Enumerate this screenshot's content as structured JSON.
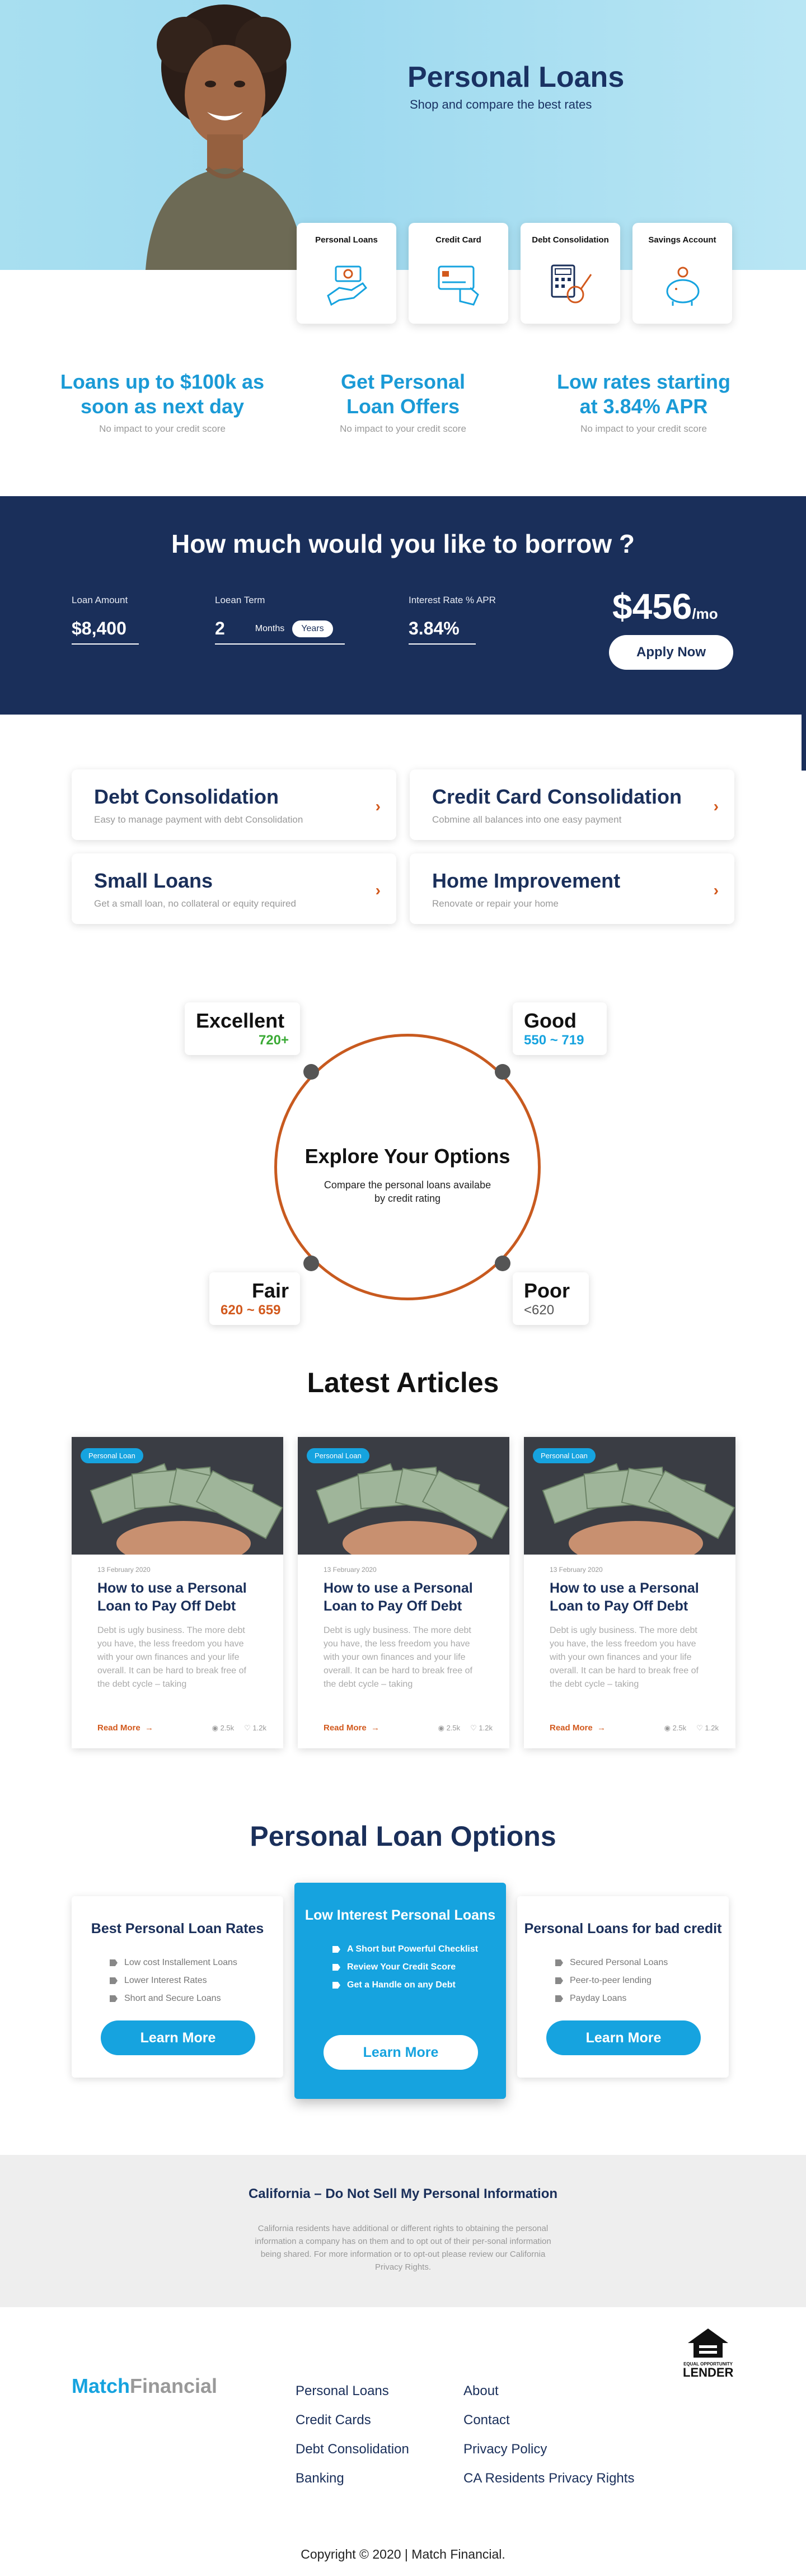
{
  "hero": {
    "title": "Personal Loans",
    "subtitle": "Shop and compare the best rates",
    "categories": [
      {
        "label": "Personal Loans",
        "icon": "hand-money-icon"
      },
      {
        "label": "Credit Card",
        "icon": "credit-card-hand-icon"
      },
      {
        "label": "Debt Consolidation",
        "icon": "calculator-invoice-icon"
      },
      {
        "label": "Savings Account",
        "icon": "piggy-bank-icon"
      }
    ]
  },
  "features": [
    {
      "title": "Loans up to $100k as soon as next day",
      "note": "No impact to your credit score"
    },
    {
      "title": "Get Personal Loan Offers",
      "note": "No impact to your credit score"
    },
    {
      "title": "Low rates starting at 3.84% APR",
      "note": "No impact to your credit score"
    }
  ],
  "borrow": {
    "title": "How much would you like to borrow ?",
    "amount_label": "Loan Amount",
    "amount_value": "$8,400",
    "term_label": "Loean Term",
    "term_value": "2",
    "term_unit_months": "Months",
    "term_unit_years": "Years",
    "rate_label": "Interest Rate % APR",
    "rate_value": "3.84%",
    "monthly_value": "$456",
    "monthly_unit": "/mo",
    "apply_label": "Apply Now"
  },
  "loan_types": [
    {
      "title": "Debt Consolidation",
      "desc": "Easy to manage payment with debt Consolidation"
    },
    {
      "title": "Credit Card Consolidation",
      "desc": "Cobmine all balances into one easy payment"
    },
    {
      "title": "Small Loans",
      "desc": "Get a small loan, no collateral or equity required"
    },
    {
      "title": "Home Improvement",
      "desc": "Renovate or repair your home"
    }
  ],
  "explore": {
    "title": "Explore Your Options",
    "subtitle": "Compare the personal loans availabe by credit rating",
    "ratings": [
      {
        "name": "Excellent",
        "range": "720+",
        "color": "#3aaa35"
      },
      {
        "name": "Good",
        "range": "550 ~ 719",
        "color": "#16a3df"
      },
      {
        "name": "Fair",
        "range": "620 ~ 659",
        "color": "#d2591d"
      },
      {
        "name": "Poor",
        "range": "<620",
        "color": "#555555"
      }
    ]
  },
  "articles": {
    "title": "Latest Articles",
    "items": [
      {
        "tag": "Personal Loan",
        "date": "13 February 2020",
        "title": "How to use a Personal Loan to Pay Off Debt",
        "excerpt": "Debt is ugly business. The more debt you have, the less freedom you have with your own finances and your life overall. It can be hard to break free of the debt cycle – taking",
        "read": "Read More",
        "views": "2.5k",
        "likes": "1.2k"
      },
      {
        "tag": "Personal Loan",
        "date": "13 February 2020",
        "title": "How to use a Personal Loan to Pay Off Debt",
        "excerpt": "Debt is ugly business. The more debt you have, the less freedom you have with your own finances and your life overall. It can be hard to break free of the debt cycle – taking",
        "read": "Read More",
        "views": "2.5k",
        "likes": "1.2k"
      },
      {
        "tag": "Personal Loan",
        "date": "13 February 2020",
        "title": "How to use a Personal Loan to Pay Off Debt",
        "excerpt": "Debt is ugly business. The more debt you have, the less freedom you have with your own finances and your life overall. It can be hard to break free of the debt cycle – taking",
        "read": "Read More",
        "views": "2.5k",
        "likes": "1.2k"
      }
    ]
  },
  "options": {
    "title": "Personal Loan Options",
    "items": [
      {
        "title": "Best Personal Loan Rates",
        "bullets": [
          "Low cost Installement Loans",
          "Lower Interest Rates",
          "Short and Secure Loans"
        ],
        "button": "Learn More"
      },
      {
        "title": "Low Interest Personal Loans",
        "bullets": [
          "A Short but Powerful Checklist",
          "Review Your Credit Score",
          "Get a Handle on any  Debt"
        ],
        "button": "Learn More"
      },
      {
        "title": "Personal Loans for bad credit",
        "bullets": [
          "Secured Personal Loans",
          "Peer-to-peer lending",
          "Payday Loans"
        ],
        "button": "Learn More"
      }
    ]
  },
  "california": {
    "title": "California – Do Not Sell My Personal Information",
    "text": "California residents have additional or different rights to obtaining the personal information a company has on them and to opt out of their per-sonal information being shared. For more information or to opt-out please review our California Privacy Rights."
  },
  "footer": {
    "logo_a": "Match",
    "logo_b": "Financial",
    "col1": [
      "Personal Loans",
      "Credit Cards",
      "Debt Consolidation",
      "Banking"
    ],
    "col2": [
      "About",
      "Contact",
      "Privacy Policy",
      "CA Residents Privacy Rights"
    ],
    "lender_cap": "EQUAL OPPORTUNITY",
    "lender_big": "LENDER",
    "copyright": "Copyright © 2020 | Match Financial."
  },
  "colors": {
    "navy": "#1a2f5a",
    "blue": "#16a3df",
    "orange": "#d2591d",
    "hero_bg": "#a8dff0"
  }
}
